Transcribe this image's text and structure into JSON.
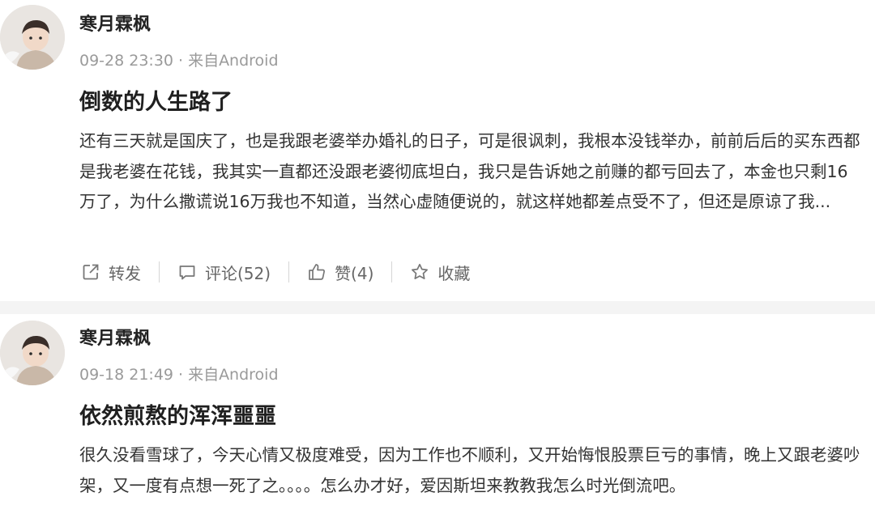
{
  "posts": [
    {
      "username": "寒月霖枫",
      "time": "09-28 23:30",
      "source": "来自Android",
      "title": "倒数的人生路了",
      "body": "还有三天就是国庆了，也是我跟老婆举办婚礼的日子，可是很讽刺，我根本没钱举办，前前后后的买东西都是我老婆在花钱，我其实一直都还没跟老婆彻底坦白，我只是告诉她之前赚的都亏回去了，本金也只剩16万了，为什么撒谎说16万我也不知道，当然心虚随便说的，就这样她都差点受不了，但还是原谅了我...",
      "actions": {
        "repost": "转发",
        "comment": "评论(52)",
        "like": "赞(4)",
        "favorite": "收藏"
      }
    },
    {
      "username": "寒月霖枫",
      "time": "09-18 21:49",
      "source": "来自Android",
      "title": "依然煎熬的浑浑噩噩",
      "body": "很久没看雪球了，今天心情又极度难受，因为工作也不顺利，又开始悔恨股票巨亏的事情，晚上又跟老婆吵架，又一度有点想一死了之。。。。怎么办才好，爱因斯坦来教教我怎么时光倒流吧。"
    }
  ],
  "meta_separator": "·",
  "colors": {
    "text": "#333333",
    "meta": "#9a9a9a",
    "divider": "#f4f4f4"
  },
  "icons": [
    "avatar-photo",
    "share-icon",
    "comment-icon",
    "thumbs-up-icon",
    "star-icon"
  ]
}
